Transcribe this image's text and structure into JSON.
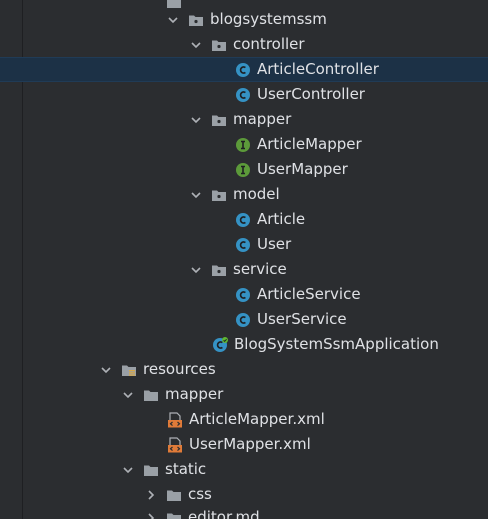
{
  "project_tree": {
    "items": [
      {
        "label": "blogsystemssm",
        "icon": "package-folder-icon",
        "expanded": true,
        "depth": 5
      },
      {
        "label": "controller",
        "icon": "package-folder-icon",
        "expanded": true,
        "depth": 6
      },
      {
        "label": "ArticleController",
        "icon": "class-icon",
        "depth": 7,
        "selected": true
      },
      {
        "label": "UserController",
        "icon": "class-icon",
        "depth": 7
      },
      {
        "label": "mapper",
        "icon": "package-folder-icon",
        "expanded": true,
        "depth": 6
      },
      {
        "label": "ArticleMapper",
        "icon": "interface-icon",
        "depth": 7
      },
      {
        "label": "UserMapper",
        "icon": "interface-icon",
        "depth": 7
      },
      {
        "label": "model",
        "icon": "package-folder-icon",
        "expanded": true,
        "depth": 6
      },
      {
        "label": "Article",
        "icon": "class-icon",
        "depth": 7
      },
      {
        "label": "User",
        "icon": "class-icon",
        "depth": 7
      },
      {
        "label": "service",
        "icon": "package-folder-icon",
        "expanded": true,
        "depth": 6
      },
      {
        "label": "ArticleService",
        "icon": "class-icon",
        "depth": 7
      },
      {
        "label": "UserService",
        "icon": "class-icon",
        "depth": 7
      },
      {
        "label": "BlogSystemSsmApplication",
        "icon": "spring-boot-class-icon",
        "depth": 6
      },
      {
        "label": "resources",
        "icon": "resources-folder-icon",
        "expanded": true,
        "depth": 3
      },
      {
        "label": "mapper",
        "icon": "folder-icon",
        "expanded": true,
        "depth": 4
      },
      {
        "label": "ArticleMapper.xml",
        "icon": "xml-file-icon",
        "depth": 5
      },
      {
        "label": "UserMapper.xml",
        "icon": "xml-file-icon",
        "depth": 5
      },
      {
        "label": "static",
        "icon": "folder-icon",
        "expanded": true,
        "depth": 4
      },
      {
        "label": "css",
        "icon": "folder-icon",
        "expanded": false,
        "depth": 5
      },
      {
        "label": "editor.md",
        "icon": "folder-icon",
        "expanded": false,
        "depth": 5
      }
    ]
  },
  "colors": {
    "background": "#2b2d30",
    "selection": "#1c3146",
    "text": "#dfe1e5",
    "class_icon": "#3592c4",
    "interface_icon": "#5c9a3a",
    "xml_icon": "#e07b39",
    "folder_icon": "#9aa0a6"
  }
}
